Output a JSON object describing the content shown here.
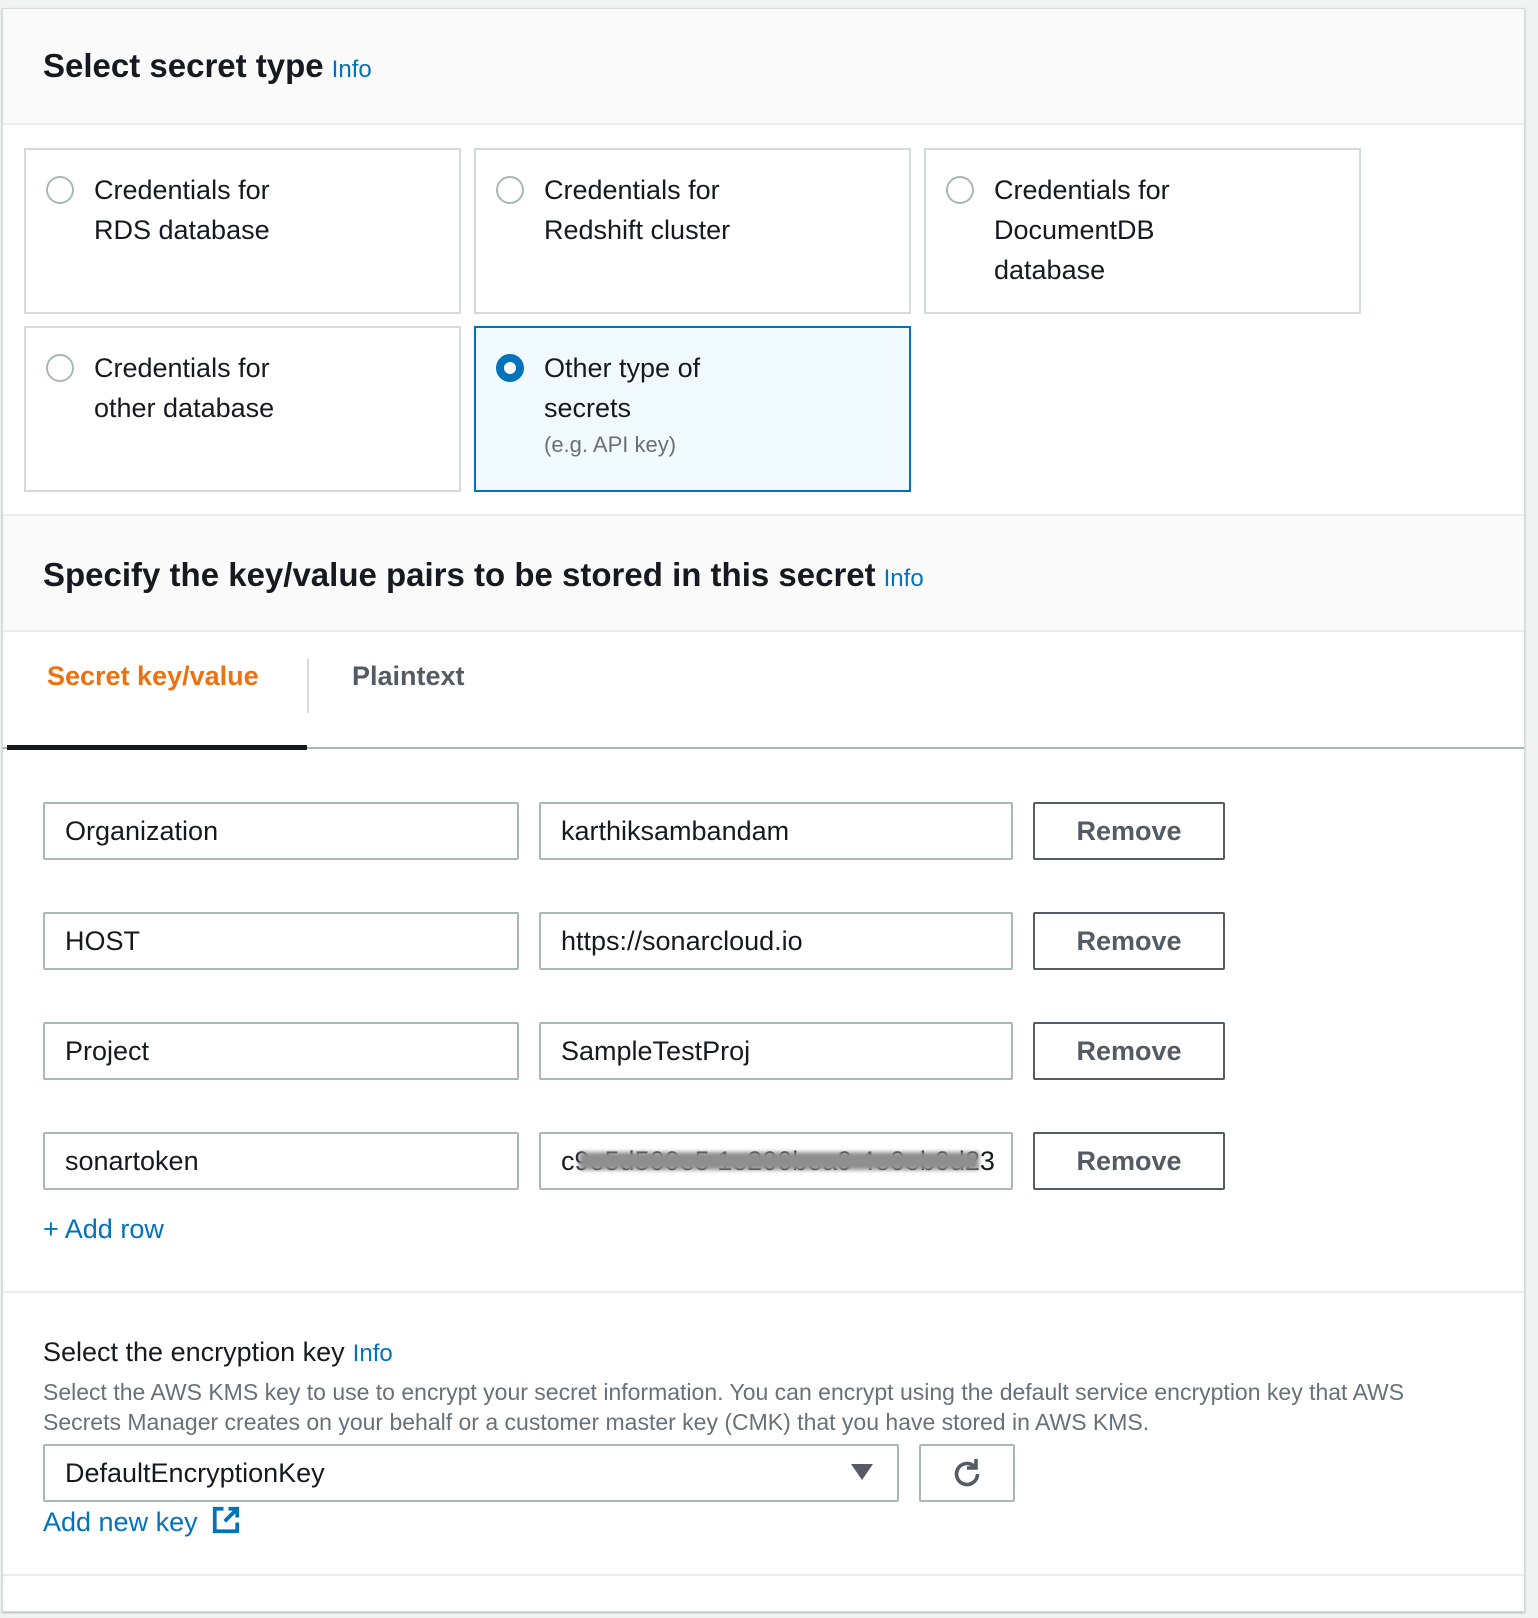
{
  "section1": {
    "title": "Select secret type",
    "info": "Info",
    "options": [
      {
        "label": "Credentials for RDS database",
        "selected": false
      },
      {
        "label": "Credentials for Redshift cluster",
        "selected": false
      },
      {
        "label": "Credentials for DocumentDB database",
        "selected": false
      },
      {
        "label": "Credentials for other database",
        "selected": false
      },
      {
        "label": "Other type of secrets",
        "sub": "(e.g. API key)",
        "selected": true
      }
    ]
  },
  "section2": {
    "title": "Specify the key/value pairs to be stored in this secret",
    "info": "Info",
    "tabs": [
      {
        "label": "Secret key/value",
        "active": true
      },
      {
        "label": "Plaintext",
        "active": false
      }
    ],
    "rows": [
      {
        "key": "Organization",
        "value": "karthiksambandam",
        "remove": "Remove"
      },
      {
        "key": "HOST",
        "value": "https://sonarcloud.io",
        "remove": "Remove"
      },
      {
        "key": "Project",
        "value": "SampleTestProj",
        "remove": "Remove"
      },
      {
        "key": "sonartoken",
        "value": "c9e5d500e5 1e200bea9 4e0eb0d23",
        "remove": "Remove",
        "redacted": true
      }
    ],
    "add_row": "+ Add row"
  },
  "encryption": {
    "label": "Select the encryption key",
    "info": "Info",
    "description": "Select the AWS KMS key to use to encrypt your secret information. You can encrypt using the default service encryption key that AWS Secrets Manager creates on your behalf or a customer master key (CMK) that you have stored in AWS KMS.",
    "selected": "DefaultEncryptionKey",
    "add_new_key": "Add new key"
  },
  "colors": {
    "accent": "#0073bb",
    "active_tab": "#ec7211"
  }
}
